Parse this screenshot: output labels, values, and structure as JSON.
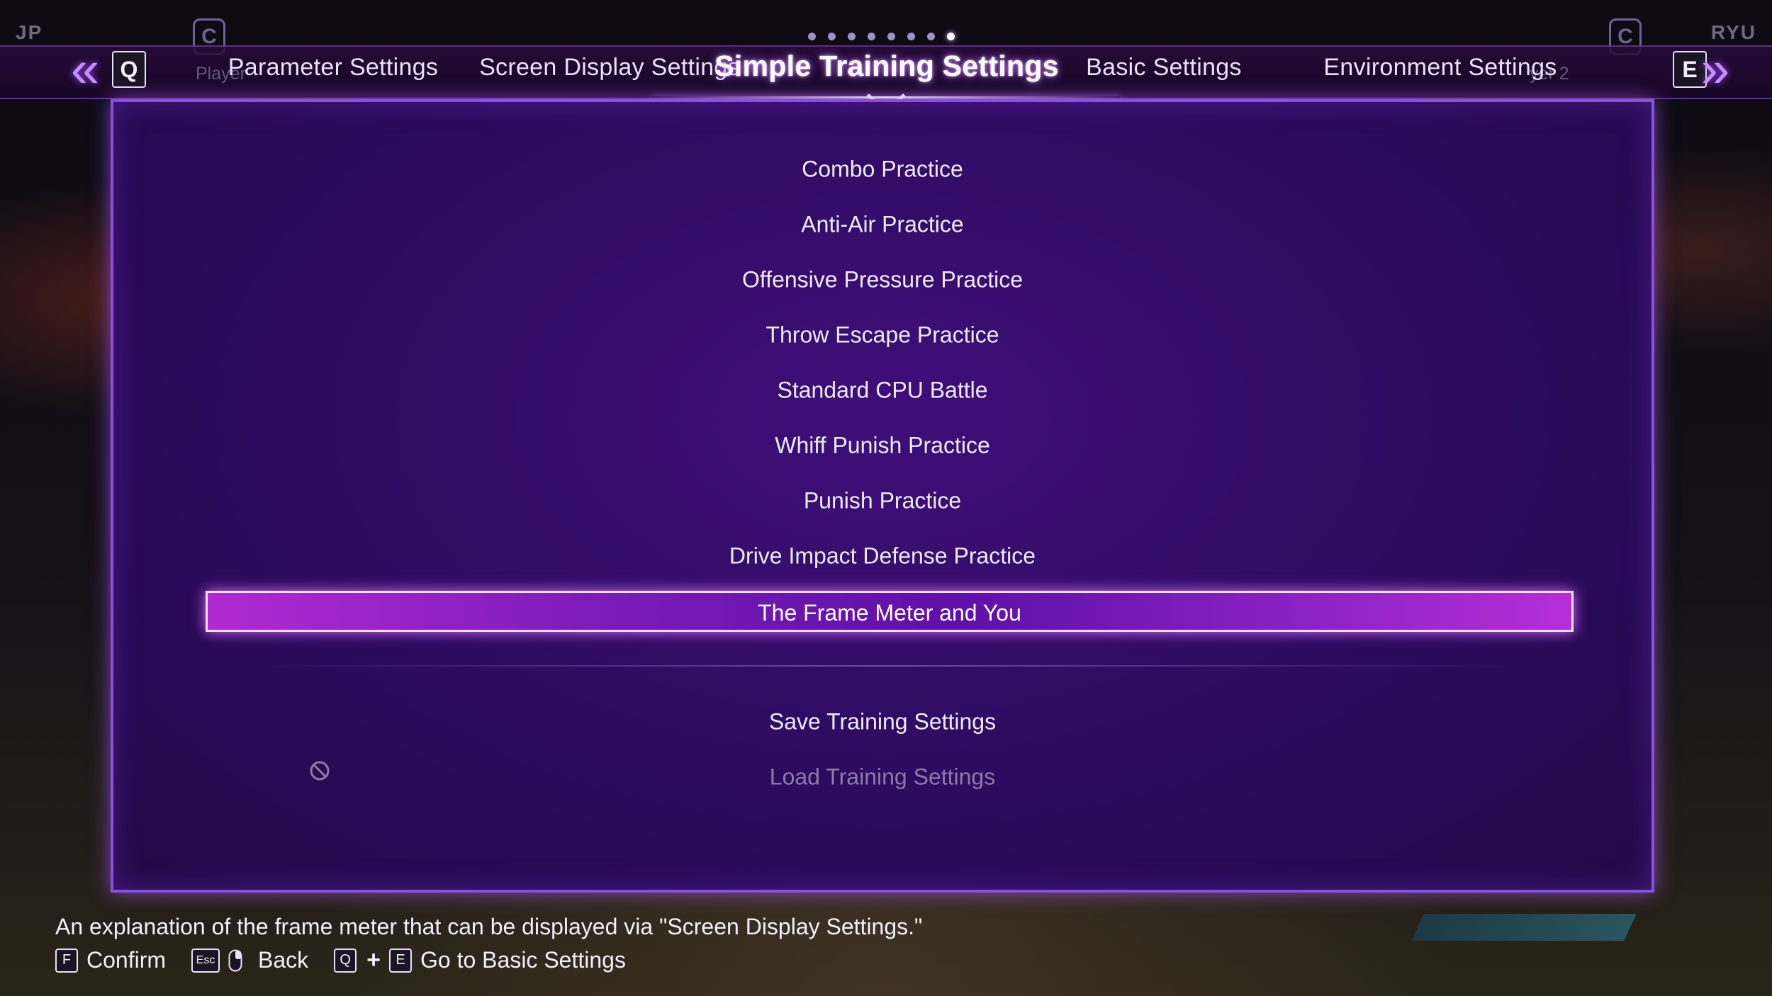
{
  "corners": {
    "left": "JP",
    "right": "RYU",
    "badge": "C"
  },
  "page_dots": {
    "total": 8,
    "active_index": 7
  },
  "tabs": {
    "ghost_left": "Player",
    "ghost_right": "yer 2",
    "prev_key": "Q",
    "next_key": "E",
    "items": [
      {
        "label": "Parameter Settings"
      },
      {
        "label": "Screen Display Settings"
      },
      {
        "label": "Simple Training Settings",
        "active": true
      },
      {
        "label": "Basic Settings"
      },
      {
        "label": "Environment Settings"
      }
    ]
  },
  "menu": {
    "items": [
      {
        "label": "Combo Practice"
      },
      {
        "label": "Anti-Air Practice"
      },
      {
        "label": "Offensive Pressure Practice"
      },
      {
        "label": "Throw Escape Practice"
      },
      {
        "label": "Standard CPU Battle"
      },
      {
        "label": "Whiff Punish Practice"
      },
      {
        "label": "Punish Practice"
      },
      {
        "label": "Drive Impact Defense Practice"
      },
      {
        "label": "The Frame Meter and You",
        "selected": true
      }
    ],
    "footer_items": [
      {
        "label": "Save Training Settings"
      },
      {
        "label": "Load Training Settings",
        "disabled": true
      }
    ]
  },
  "description": "An explanation of the frame meter that can be displayed via \"Screen Display Settings.\"",
  "hints": {
    "confirm_key": "F",
    "confirm_label": "Confirm",
    "back_key": "Esc",
    "back_label": "Back",
    "goto_key_1": "Q",
    "goto_key_2": "E",
    "goto_label": "Go to Basic Settings"
  },
  "colors": {
    "accent": "#b02bd0",
    "panel": "#2c0a5c",
    "border": "#8a4fe0"
  }
}
